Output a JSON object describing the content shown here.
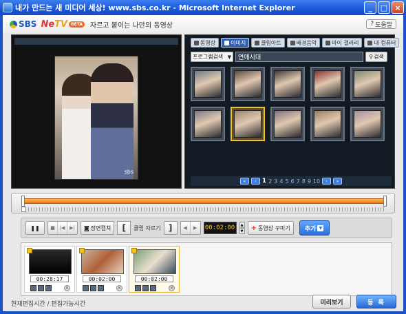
{
  "window": {
    "title": "내가 만드는 새 미디어 세상! www.sbs.co.kr - Microsoft Internet Explorer",
    "minimize_label": "_",
    "maximize_label": "□",
    "close_label": "×"
  },
  "header": {
    "sbs_logo": "SBS",
    "netv_logo_ne": "Ne",
    "netv_logo_tv": "TV",
    "beta_badge": "BETA",
    "tagline": "자르고 붙이는 나만의 동영상",
    "help_label": "도움말"
  },
  "library": {
    "tabs": [
      {
        "label": "동영상",
        "active": false
      },
      {
        "label": "이미지",
        "active": true
      },
      {
        "label": "클립아트",
        "active": false
      },
      {
        "label": "배경음악",
        "active": false
      },
      {
        "label": "마이 갤러리",
        "active": false
      },
      {
        "label": "내 컴퓨터",
        "active": false
      }
    ],
    "search": {
      "category": "프로그램검색",
      "query": "연애시대",
      "button_label": "검색"
    },
    "thumbnails": [
      {
        "bg": "#6d7b8a",
        "selected": false
      },
      {
        "bg": "#5a4a40",
        "selected": false
      },
      {
        "bg": "#403a3a",
        "selected": false
      },
      {
        "bg": "#8a3030",
        "selected": false
      },
      {
        "bg": "#7a8a70",
        "selected": false
      },
      {
        "bg": "#7a7a8a",
        "selected": false
      },
      {
        "bg": "#a08870",
        "selected": true
      },
      {
        "bg": "#807080",
        "selected": false
      },
      {
        "bg": "#9a8060",
        "selected": false
      },
      {
        "bg": "#aa90a0",
        "selected": false
      }
    ],
    "pager": {
      "first": "«",
      "prev": "‹",
      "pages": [
        "1",
        "2",
        "3",
        "4",
        "5",
        "6",
        "7",
        "8",
        "9",
        "10"
      ],
      "current_page": "1",
      "next": "›",
      "last": "»"
    }
  },
  "preview": {
    "watermark": "sbs"
  },
  "controls": {
    "pause_label": "❚❚",
    "stop_label": "■",
    "prev_label": "|◀",
    "next_label": "▶|",
    "capture_label": "장면캡쳐",
    "clip_cut_label": "클립 자르기",
    "bracket_in": "[",
    "bracket_out": "]",
    "vol_down_label": "◀",
    "vol_up_label": "▶",
    "time_value": "00:02:00",
    "decorate_label": "동영상 꾸미기",
    "add_label": "추가"
  },
  "clips": [
    {
      "time": "00:28:17",
      "selected": false
    },
    {
      "time": "00:02:00",
      "selected": false
    },
    {
      "time": "00:02:00",
      "selected": true
    }
  ],
  "footer": {
    "edit_time_text": "현재편집시간 / 편집가능시간",
    "preview_button": "미리보기",
    "register_button": "등 록"
  }
}
